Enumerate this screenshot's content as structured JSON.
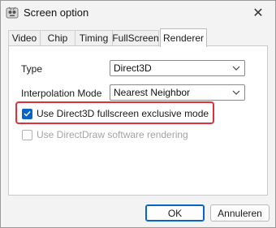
{
  "window": {
    "title": "Screen option",
    "icon": "app-icon",
    "close_label": "✕"
  },
  "tabs": [
    {
      "label": "Video"
    },
    {
      "label": "Chip"
    },
    {
      "label": "Timing"
    },
    {
      "label": "FullScreen"
    },
    {
      "label": "Renderer",
      "active": true
    }
  ],
  "renderer": {
    "type_label": "Type",
    "type_value": "Direct3D",
    "interpolation_label": "Interpolation Mode",
    "interpolation_value": "Nearest Neighbor",
    "exclusive_label": "Use Direct3D fullscreen exclusive mode",
    "exclusive_checked": true,
    "directdraw_label": "Use DirectDraw software rendering",
    "directdraw_checked": false,
    "directdraw_disabled": true
  },
  "buttons": {
    "ok_label": "OK",
    "cancel_label": "Annuleren"
  },
  "colors": {
    "accent": "#0a64c8",
    "highlight": "#e0303a"
  }
}
